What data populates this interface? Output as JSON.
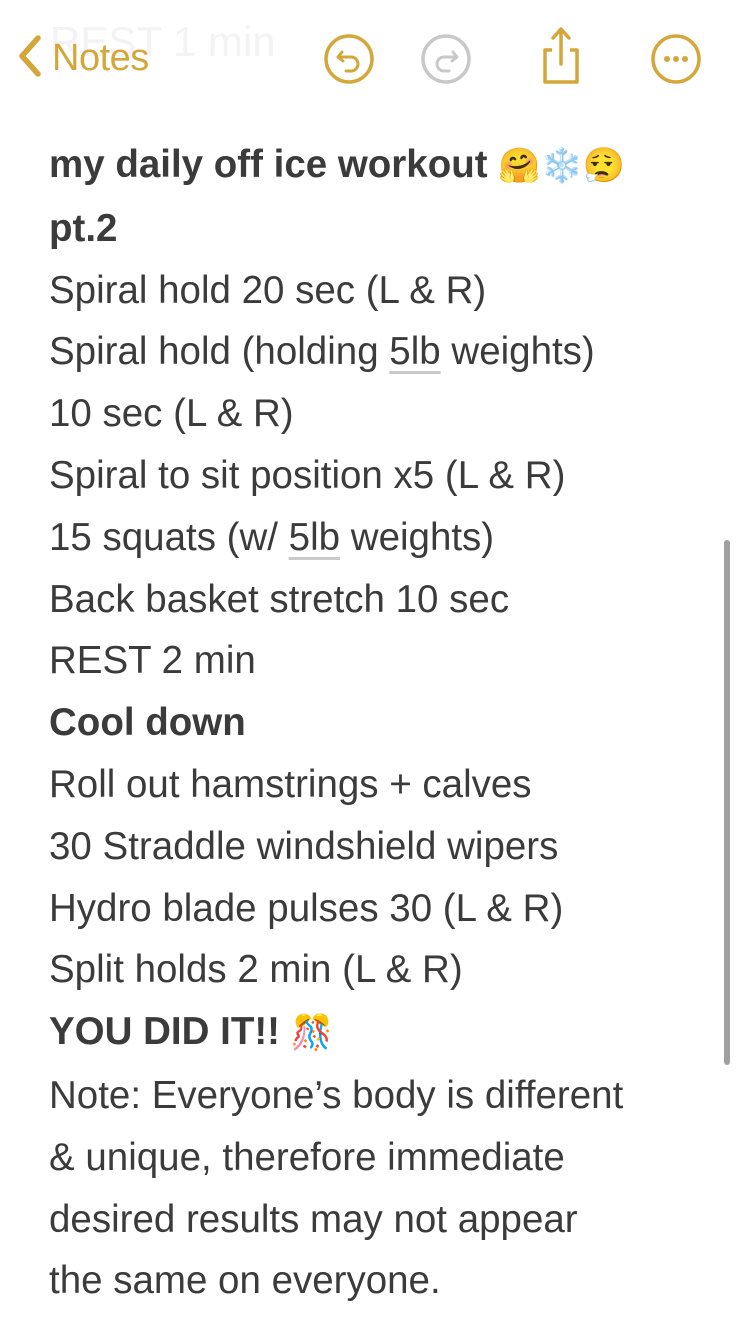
{
  "nav": {
    "back_label": "Notes",
    "ghost_text": "REST 1 min",
    "icons": {
      "back": "chevron-left-icon",
      "undo": "undo-icon",
      "redo": "redo-icon",
      "share": "share-icon",
      "more": "ellipsis-circle-icon"
    },
    "accent_color": "#d4a73a",
    "disabled_color": "#c8c8c8"
  },
  "note": {
    "title_line1": "my daily off ice workout",
    "title_emojis": "🤗❄️😮‍💨",
    "title_line2": "pt.2",
    "lines": {
      "l1": "Spiral hold 20 sec (L & R)",
      "l2_pre": "Spiral hold (holding ",
      "l2_link": "5lb",
      "l2_post": " weights)",
      "l3": "10 sec (L & R)",
      "l4": "Spiral to sit position x5 (L & R)",
      "l5_pre": "15 squats (w/ ",
      "l5_link": "5lb",
      "l5_post": " weights)",
      "l6": "Back basket stretch 10 sec",
      "l7": "REST 2 min"
    },
    "cooldown_heading": "Cool down",
    "cooldown": {
      "c1": "Roll out hamstrings + calves",
      "c2": "30 Straddle windshield wipers",
      "c3": "Hydro blade pulses 30 (L & R)",
      "c4": "Split holds 2 min (L & R)"
    },
    "finish": "YOU DID IT!!",
    "finish_emoji": "🎊",
    "disclaimer": {
      "d1": "Note: Everyone’s body is different",
      "d2": "& unique, therefore immediate",
      "d3": "desired results may not appear",
      "d4": "the same on everyone."
    }
  }
}
